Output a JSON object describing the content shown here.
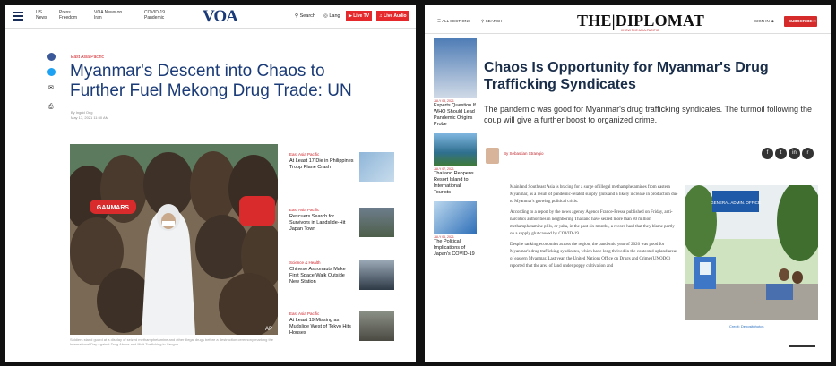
{
  "voa": {
    "nav": [
      "US News",
      "Press Freedom",
      "VOA News on Iran",
      "COVID-19 Pandemic"
    ],
    "logo": "VOA",
    "search": "Search",
    "lang": "Lang",
    "live_tv": "Live TV",
    "live_audio": "Live Audio",
    "kicker": "East Asia Pacific",
    "headline": "Myanmar's Descent into Chaos to Further Fuel Mekong Drug Trade: UN",
    "byline": [
      "By Ingrid Ong",
      "May 17, 2021 11:50 AM"
    ],
    "photo_sign_left": "GANMARS",
    "photo_credit": "AP",
    "caption": "Soldiers stand guard at a display of seized methamphetamine and other illegal drugs before a destruction ceremony marking the International Day Against Drug Abuse and Illicit Trafficking in Yangon.",
    "side": [
      {
        "kicker": "East Asia Pacific",
        "title": "At Least 17 Die in Philippines Troop Plane Crash"
      },
      {
        "kicker": "East Asia Pacific",
        "title": "Rescuers Search for Survivors in Landslide-Hit Japan Town"
      },
      {
        "kicker": "Science & Health",
        "title": "Chinese Astronauts Make First Space Walk Outside New Station"
      },
      {
        "kicker": "East Asia Pacific",
        "title": "At Least 19 Missing as Mudslide West of Tokyo Hits Houses"
      }
    ]
  },
  "diplomat": {
    "all_sections": "ALL SECTIONS",
    "search": "SEARCH",
    "logo": "THE|DIPLOMAT",
    "tagline": "KNOW THE ASIA-PACIFIC",
    "sign_in": "SIGN IN",
    "subscribe": "SUBSCRIBE",
    "left": [
      {
        "date": "JULY 08, 2021",
        "title": "Experts Question If WHO Should Lead Pandemic Origins Probe"
      },
      {
        "date": "JULY 07, 2021",
        "title": "Thailand Reopens Resort Island to International Tourists"
      },
      {
        "date": "JULY 06, 2021",
        "title": "The Political Implications of Japan's COVID-19"
      }
    ],
    "headline": "Chaos Is Opportunity for Myanmar's Drug Trafficking Syndicates",
    "standfirst": "The pandemic was good for Myanmar's drug trafficking syndicates. The turmoil following the coup will give a further boost to organized crime.",
    "author": "By Sebastian Strangio",
    "share": [
      "f",
      "t",
      "in",
      "r"
    ],
    "body": [
      "Mainland Southeast Asia is bracing for a surge of illegal methamphetamines from eastern Myanmar, as a result of pandemic-related supply gluts and a likely increase in production due to Myanmar's growing political crisis.",
      "According to a report by the news agency Agence France-Presse published on Friday, anti-narcotics authorities in neighboring Thailand have seized more than 80 million methamphetamine pills, or yaba, in the past six months, a record haul that they blame partly on a supply glut caused by COVID-19.",
      "Despite tanking economies across the region, the pandemic year of 2020 was good for Myanmar's drug trafficking syndicates, which have long thrived in the contested upland areas of eastern Myanmar. Last year, the United Nations Office on Drugs and Crime (UNODC) reported that the area of land under poppy cultivation and"
    ],
    "photo_sign": "GENERAL ADMIN. OFFICE",
    "photo_credit": "Credit: Depositphotos"
  }
}
